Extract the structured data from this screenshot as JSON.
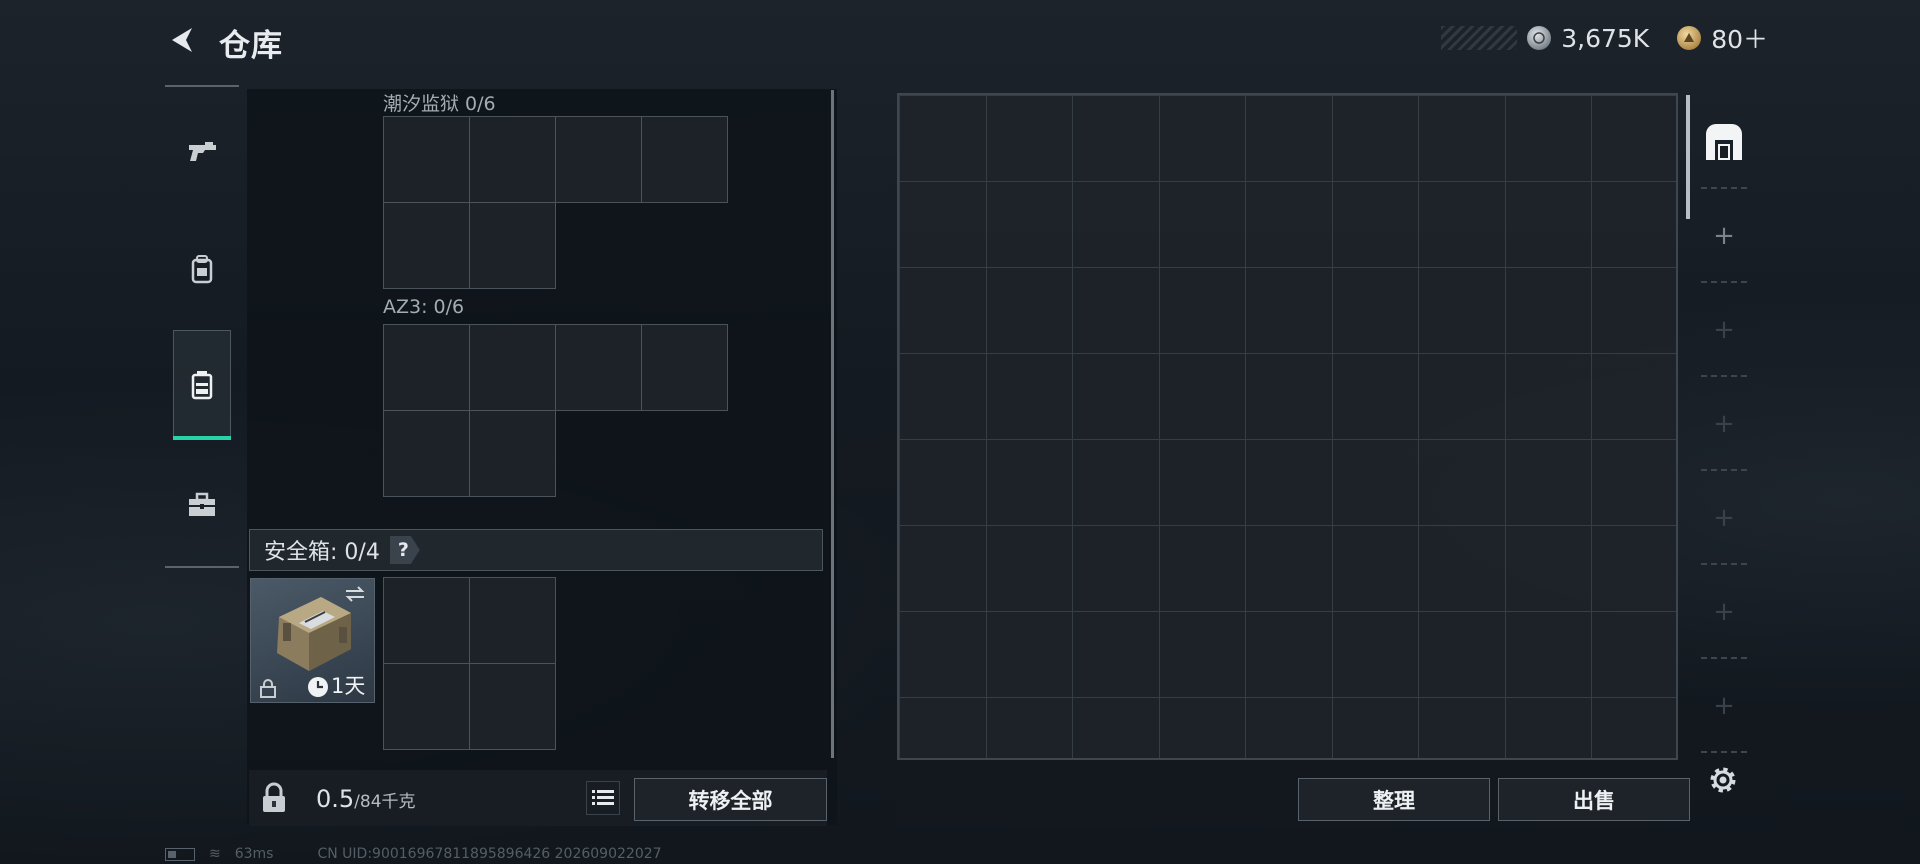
{
  "header": {
    "title": "仓库",
    "currency": [
      {
        "icon": "silver-coin-icon",
        "value": "3,675K"
      },
      {
        "icon": "gold-coin-icon",
        "value": "80＋"
      }
    ]
  },
  "left_rail": {
    "items": [
      {
        "name": "weapons",
        "icon": "gun-icon",
        "active": false
      },
      {
        "name": "gear",
        "icon": "backpack-gear-icon",
        "active": false
      },
      {
        "name": "backpack",
        "icon": "backpack-icon",
        "active": true
      },
      {
        "name": "supplies",
        "icon": "toolbox-icon",
        "active": false
      }
    ]
  },
  "containers": {
    "box1_label": "潮汐监狱 0/6",
    "box2_label": "AZ3: 0/6",
    "secure_label": "安全箱: 0/4",
    "help": "?",
    "secure_case": {
      "timer": "1天",
      "locked": true
    }
  },
  "weight": {
    "current": "0.5",
    "max": "/84千克"
  },
  "buttons": {
    "transfer_all": "转移全部",
    "organize": "整理",
    "sell": "出售"
  },
  "stash": {
    "columns": 9,
    "rows": 8
  },
  "right_rail": {
    "tabs": [
      "main-stash",
      "add",
      "add",
      "add",
      "add",
      "add",
      "add"
    ]
  },
  "status": {
    "ping": "63ms",
    "uid": "CN UID:900169678118958964​26  2026090220​27"
  }
}
